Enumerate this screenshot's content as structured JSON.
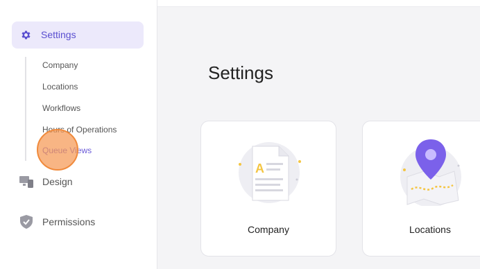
{
  "sidebar": {
    "settings_label": "Settings",
    "sub_items": [
      {
        "label": "Company"
      },
      {
        "label": "Locations"
      },
      {
        "label": "Workflows"
      },
      {
        "label": "Hours of Operations"
      },
      {
        "label": "Queue Views"
      }
    ],
    "design_label": "Design",
    "permissions_label": "Permissions",
    "active_color": "#6b5bd8"
  },
  "main": {
    "title": "Settings",
    "cards": [
      {
        "label": "Company",
        "icon": "document-icon"
      },
      {
        "label": "Locations",
        "icon": "map-pin-icon"
      }
    ]
  }
}
